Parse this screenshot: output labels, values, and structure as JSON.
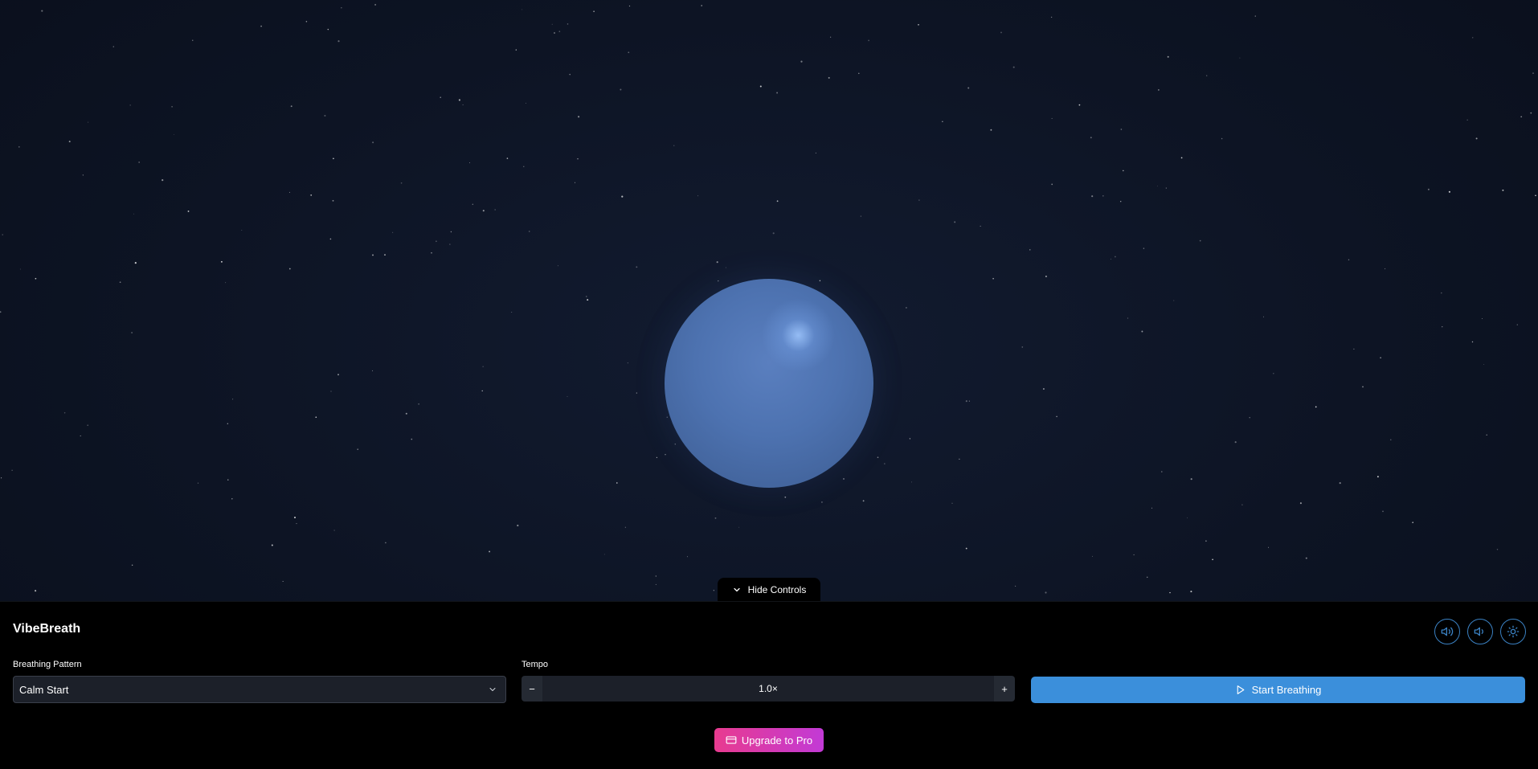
{
  "app": {
    "title": "VibeBreath"
  },
  "toggle": {
    "label": "Hide Controls",
    "icon": "chevron-down-icon"
  },
  "orb": {
    "color": "#4d72b0",
    "highlight": "#a0c8ff"
  },
  "header_icons": [
    {
      "name": "sound-on-icon"
    },
    {
      "name": "volume-icon"
    },
    {
      "name": "sun-icon"
    }
  ],
  "pattern": {
    "label": "Breathing Pattern",
    "selected": "Calm Start"
  },
  "tempo": {
    "label": "Tempo",
    "value": "1.0×",
    "decrement": "−",
    "increment": "+"
  },
  "start_button": {
    "label": "Start Breathing",
    "icon": "play-icon"
  },
  "upgrade_button": {
    "label": "Upgrade to Pro",
    "icon": "card-icon"
  },
  "colors": {
    "background": "#0d1424",
    "panel": "#000000",
    "accent": "#3b8fdb",
    "upgrade_gradient_start": "#e83b8f",
    "upgrade_gradient_end": "#c23ad6"
  }
}
